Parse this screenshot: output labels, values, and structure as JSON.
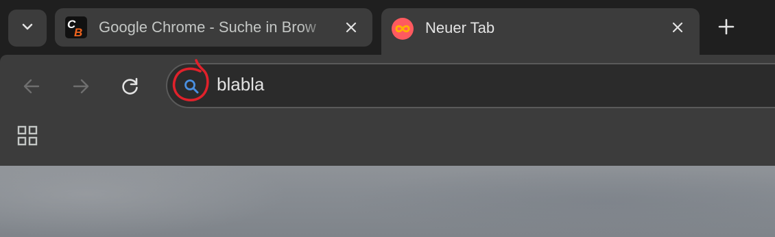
{
  "tabs": [
    {
      "title": "Google Chrome - Suche in Brow",
      "favicon": "cb-logo-icon",
      "favicon_text": "CB",
      "active": false
    },
    {
      "title": "Neuer Tab",
      "favicon": "infinity-icon",
      "active": true
    }
  ],
  "omnibox": {
    "value": "blabla",
    "icon": "search-icon",
    "annotation_color": "#e0212b"
  },
  "colors": {
    "frame": "#1f1f1f",
    "toolbar": "#3c3c3c",
    "omnibox": "#2b2b2b",
    "search_icon": "#4a90e2",
    "tab_favicon_bg": "#ff5a5f",
    "tab_favicon_fg": "#ffb000"
  }
}
